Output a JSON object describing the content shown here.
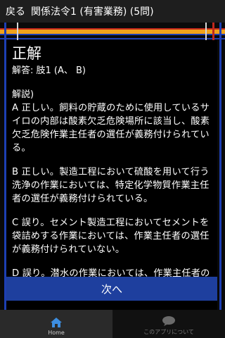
{
  "titlebar": {
    "back_label": "戻る",
    "title": "関係法令1 (有害業務) (5問)"
  },
  "result": {
    "heading": "正解",
    "answer": "解答: 肢1 (A、 B)"
  },
  "explanation": {
    "label": "解説)",
    "paragraphs": [
      "A 正しい。飼料の貯蔵のために使用しているサイロの内部は酸素欠乏危険場所に該当し、酸素欠乏危険作業主任者の選任が義務付けられている。",
      "B 正しい。製造工程において硫酸を用いて行う洗浄の作業においては、特定化学物質作業主任者の選任が義務付けられている。",
      "C 誤り。セメント製造工程においてセメントを袋詰めする作業においては、作業主任者の選任が義務付けられていない。",
      "D 誤り。潜水の作業においては、作業主任者の選任が義務付けられていない。"
    ]
  },
  "next_button": "次へ",
  "tabbar": {
    "tabs": [
      {
        "label": "Home",
        "icon": "home-icon"
      },
      {
        "label": "このアプリについて",
        "icon": "speech-bubble-icon"
      }
    ]
  },
  "colors": {
    "accent_blue": "#1e3f9e",
    "home_icon_blue": "#3d8ee0",
    "orange": "#f0a21a",
    "red": "#c0281c"
  }
}
